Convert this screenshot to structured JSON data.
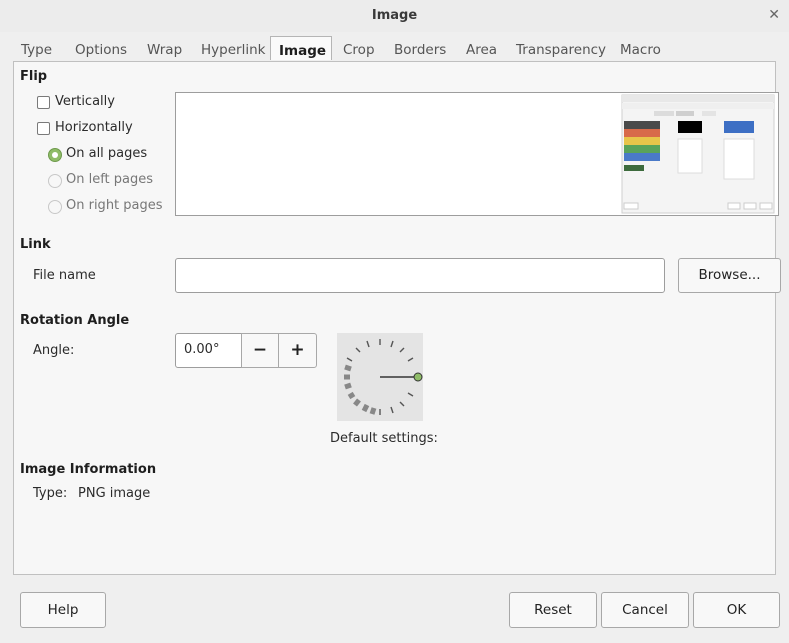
{
  "window": {
    "title": "Image"
  },
  "tabs": [
    "Type",
    "Options",
    "Wrap",
    "Hyperlink",
    "Image",
    "Crop",
    "Borders",
    "Area",
    "Transparency",
    "Macro"
  ],
  "active_tab": "Image",
  "flip": {
    "heading": "Flip",
    "vertically": "Vertically",
    "horizontally": "Horizontally",
    "on_all_pages": "On all pages",
    "on_left_pages": "On left pages",
    "on_right_pages": "On right pages"
  },
  "link": {
    "heading": "Link",
    "file_name_label": "File name",
    "file_name_value": "",
    "browse": "Browse..."
  },
  "rotation": {
    "heading": "Rotation Angle",
    "angle_label": "Angle:",
    "angle_value": "0.00°",
    "minus": "−",
    "plus": "+",
    "default_settings": "Default settings:"
  },
  "image_info": {
    "heading": "Image Information",
    "type_label": "Type:",
    "type_value": "PNG image"
  },
  "buttons": {
    "help": "Help",
    "reset": "Reset",
    "cancel": "Cancel",
    "ok": "OK"
  },
  "colors": {
    "accent_green": "#8fbc68",
    "thumb_blue": "#3d6fc4"
  }
}
